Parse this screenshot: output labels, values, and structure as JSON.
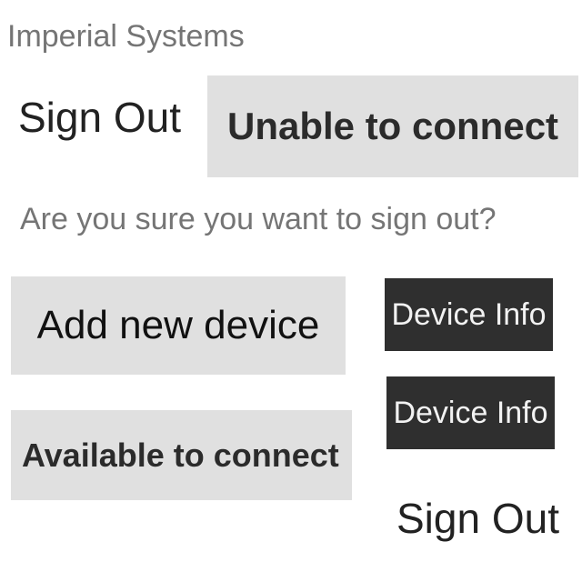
{
  "app": {
    "title": "Imperial Systems"
  },
  "actions": {
    "sign_out_top": "Sign Out",
    "add_device": "Add new device",
    "device_info_1": "Device Info",
    "device_info_2": "Device Info",
    "sign_out_bottom": "Sign Out"
  },
  "status": {
    "unable": "Unable to connect",
    "available": "Available to connect"
  },
  "dialog": {
    "confirm_question": "Are you sure you want to sign out?"
  },
  "colors": {
    "light_button": "#e0e0e0",
    "dark_button": "#2f2f2f",
    "muted_text": "#757575"
  }
}
